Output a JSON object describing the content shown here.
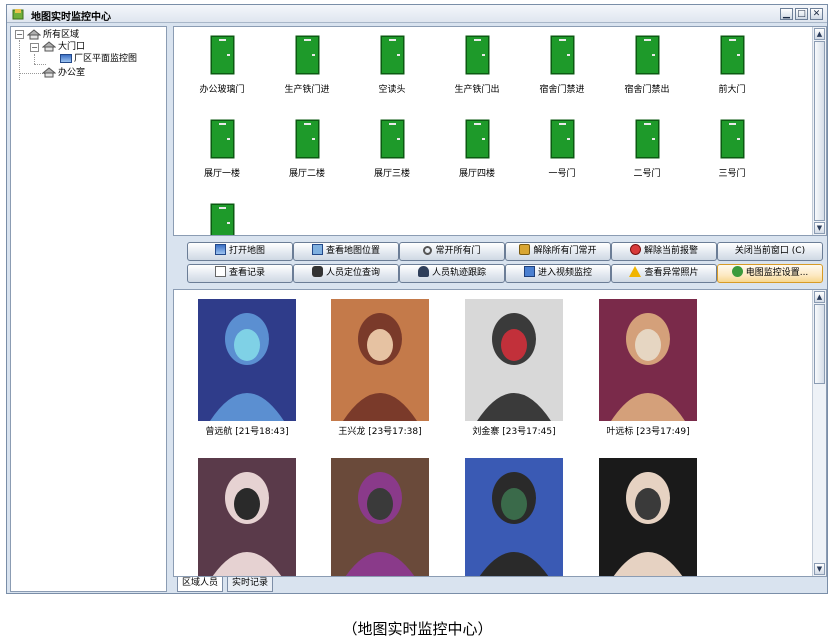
{
  "window": {
    "title": "地图实时监控中心",
    "minimize_glyph": "▁",
    "restore_glyph": "□",
    "close_glyph": "✕"
  },
  "tree": {
    "root": {
      "label": "所有区域",
      "expander": "−"
    },
    "gate": {
      "label": "大门口",
      "expander": "−"
    },
    "plan": {
      "label": "厂区平面监控图"
    },
    "office": {
      "label": "办公室"
    }
  },
  "doors": [
    {
      "label": "办公玻璃门"
    },
    {
      "label": "生产铁门进"
    },
    {
      "label": "空读头"
    },
    {
      "label": "生产铁门出"
    },
    {
      "label": "宿舍门禁进"
    },
    {
      "label": "宿舍门禁出"
    },
    {
      "label": "前大门"
    },
    {
      "label": "展厅一楼"
    },
    {
      "label": "展厅二楼"
    },
    {
      "label": "展厅三楼"
    },
    {
      "label": "展厅四楼"
    },
    {
      "label": "一号门"
    },
    {
      "label": "二号门"
    },
    {
      "label": "三号门"
    },
    {
      "label": ""
    }
  ],
  "toolbar": {
    "open_map": "打开地图",
    "view_map_position": "查看地图位置",
    "open_all_doors": "常开所有门",
    "release_all_open": "解除所有门常开",
    "release_alarm": "解除当前报警",
    "close_window": "关闭当前窗口 (C)",
    "view_records": "查看记录",
    "locate_person": "人员定位查询",
    "track_person": "人员轨迹跟踪",
    "video_monitor": "进入视频监控",
    "abnormal_photos": "查看异常照片",
    "map_settings": "电图监控设置..."
  },
  "people": [
    {
      "caption": "曾远航 [21号18:43]"
    },
    {
      "caption": "王兴龙 [23号17:38]"
    },
    {
      "caption": "刘金寨 [23号17:45]"
    },
    {
      "caption": "叶远标 [23号17:49]"
    },
    {
      "caption": ""
    },
    {
      "caption": ""
    },
    {
      "caption": ""
    },
    {
      "caption": ""
    }
  ],
  "tabs": {
    "zone_people": "区域人员",
    "realtime_records": "实时记录"
  },
  "figure_caption": "（地图实时监控中心）",
  "colors": {
    "door": "#1e9a2a",
    "door_dark": "#0b5a12",
    "frame": "#d9e3ef",
    "accent": "#f7d78f"
  }
}
